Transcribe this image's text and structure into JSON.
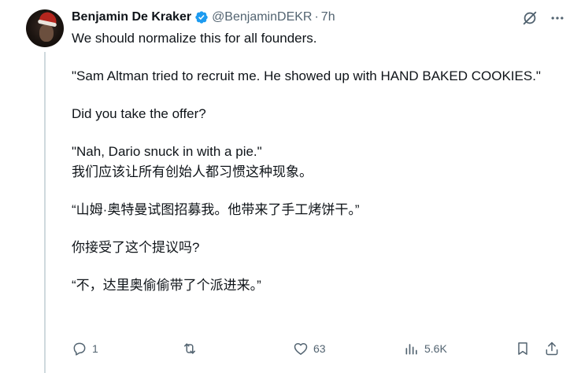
{
  "tweet": {
    "author_name": "Benjamin De Kraker",
    "handle": "@BenjaminDEKR",
    "separator": "·",
    "time": "7h",
    "paragraphs": [
      "We should normalize this for all founders.",
      "\"Sam Altman tried to recruit me. He showed up with HAND BAKED COOKIES.\"",
      "Did you take the offer?",
      "\"Nah, Dario snuck in with a pie.\"",
      "我们应该让所有创始人都习惯这种现象。",
      "“山姆·奥特曼试图招募我。他带来了手工烤饼干。”",
      "你接受了这个提议吗?",
      "“不，达里奥偷偷带了个派进来。”"
    ],
    "replies": "1",
    "retweets": "",
    "likes": "63",
    "views": "5.6K"
  },
  "icons": {
    "verified": "verified-badge-icon",
    "grok": "grok-icon",
    "more": "more-icon",
    "reply": "reply-icon",
    "retweet": "retweet-icon",
    "like": "heart-icon",
    "views": "views-icon",
    "bookmark": "bookmark-icon",
    "share": "share-icon"
  },
  "colors": {
    "text": "#0f1419",
    "secondary": "#536471",
    "verified": "#1d9bf0",
    "thread_line": "#cfd9de"
  }
}
